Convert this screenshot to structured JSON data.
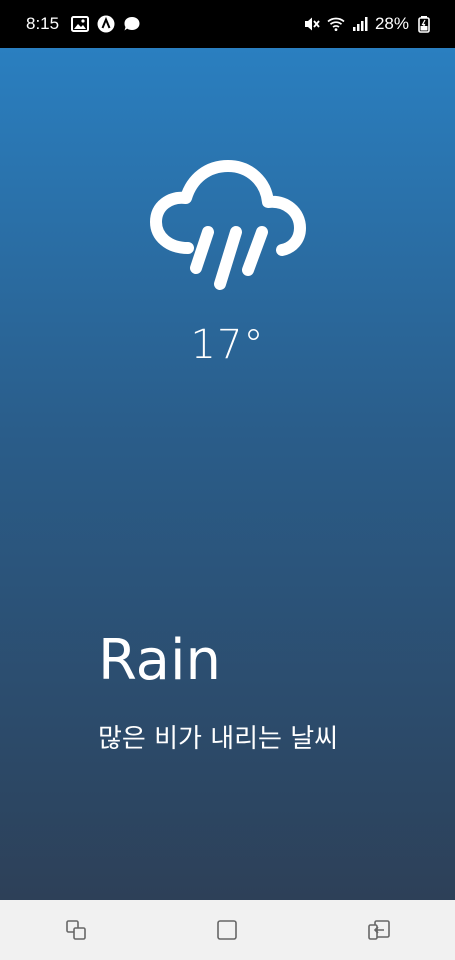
{
  "status_bar": {
    "time": "8:15",
    "battery": "28%",
    "left_icons": [
      "image-icon",
      "notification-a-icon",
      "chat-bubble-icon"
    ],
    "right_icons": [
      "mute-icon",
      "wifi-icon",
      "signal-icon",
      "battery-charging-icon"
    ]
  },
  "weather": {
    "icon": "rain-cloud-icon",
    "temperature": "17°",
    "condition": "Rain",
    "description": "많은 비가 내리는 날씨"
  },
  "colors": {
    "gradient_top": "#2a7fc0",
    "gradient_bottom": "#2d4058",
    "nav_bar": "#f1f1f1"
  },
  "nav_bar": {
    "buttons": [
      "recent-apps-icon",
      "home-icon",
      "back-icon"
    ]
  }
}
